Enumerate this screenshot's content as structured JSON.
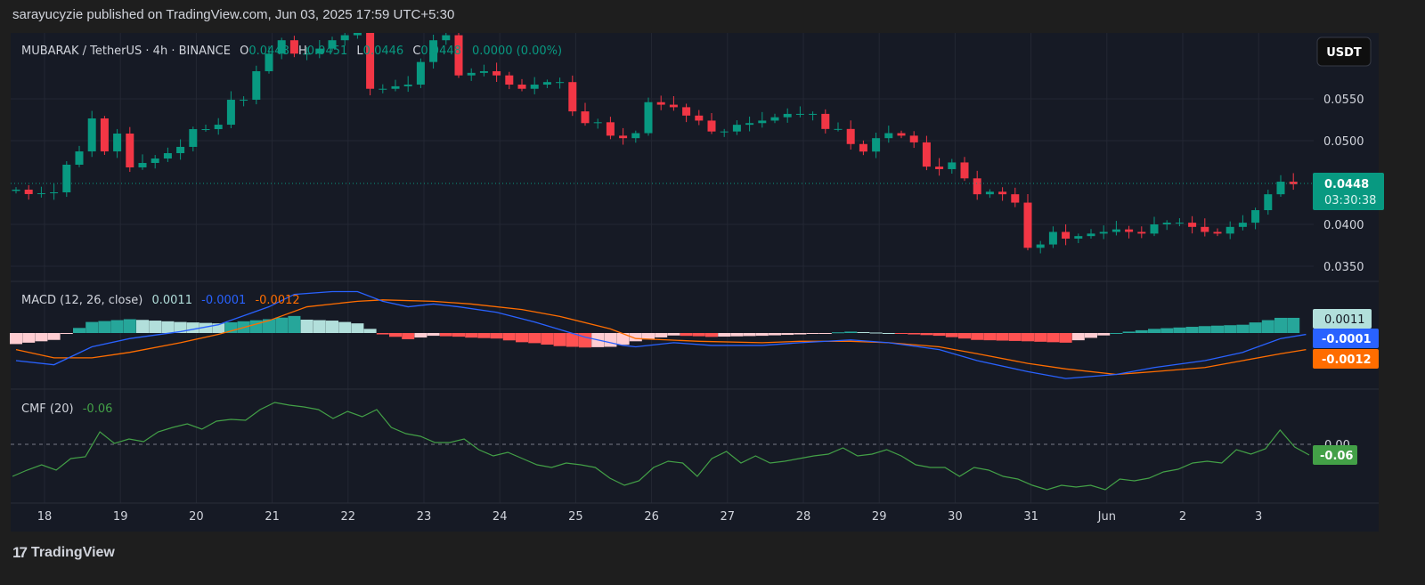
{
  "header": {
    "published": "sarayucyzie published on TradingView.com, Jun 03, 2025 17:59 UTC+5:30"
  },
  "legend": {
    "symbol": "MUBARAK / TetherUS · 4h · BINANCE",
    "o_label": "O",
    "o": "0.0448",
    "h_label": "H",
    "h": "0.0451",
    "l_label": "L",
    "l": "0.0446",
    "c_label": "C",
    "c": "0.0448",
    "change": "0.0000 (0.00%)"
  },
  "currency_button": "USDT",
  "footer": {
    "brand": "TradingView"
  },
  "colors": {
    "up": "#089981",
    "down": "#f23645",
    "macd": "#2962ff",
    "signal": "#ff6d00",
    "cmf": "#43a047",
    "bg": "#161a25"
  },
  "chart_data": [
    {
      "type": "candlestick",
      "title": "MUBARAK / TetherUS 4h",
      "price_ticks": [
        "0.0550",
        "0.0500",
        "0.0400",
        "0.0350"
      ],
      "price_tick_values": [
        0.055,
        0.05,
        0.04,
        0.035
      ],
      "x_ticks": [
        "18",
        "19",
        "20",
        "21",
        "22",
        "23",
        "24",
        "25",
        "26",
        "27",
        "28",
        "29",
        "30",
        "31",
        "Jun",
        "2",
        "3"
      ],
      "last_price": "0.0448",
      "countdown": "03:30:38",
      "first_open": 0.044,
      "closes": [
        0.04415,
        0.04362,
        0.04372,
        0.04383,
        0.04713,
        0.04872,
        0.05266,
        0.04872,
        0.05085,
        0.04681,
        0.04734,
        0.04787,
        0.04851,
        0.04926,
        0.05138,
        0.05138,
        0.05191,
        0.05489,
        0.05489,
        0.0583,
        0.0604,
        0.062,
        0.0604,
        0.0604,
        0.061,
        0.062,
        0.0626,
        0.0636,
        0.0562,
        0.0562,
        0.0565,
        0.0567,
        0.0594,
        0.062,
        0.0626,
        0.0578,
        0.0581,
        0.0583,
        0.0578,
        0.0567,
        0.0562,
        0.0567,
        0.057,
        0.057,
        0.0535,
        0.0521,
        0.0522,
        0.0506,
        0.0503,
        0.0509,
        0.0546,
        0.0543,
        0.054,
        0.053,
        0.0524,
        0.0511,
        0.0511,
        0.0519,
        0.0521,
        0.0524,
        0.0528,
        0.0532,
        0.0532,
        0.0532,
        0.0514,
        0.0514,
        0.0496,
        0.0487,
        0.0503,
        0.0509,
        0.0506,
        0.0498,
        0.0469,
        0.0466,
        0.0474,
        0.0455,
        0.0436,
        0.0439,
        0.0436,
        0.0426,
        0.0372,
        0.0376,
        0.0391,
        0.0383,
        0.0386,
        0.0389,
        0.0391,
        0.0394,
        0.0391,
        0.0389,
        0.04,
        0.0402,
        0.0402,
        0.0397,
        0.0391,
        0.0389,
        0.0397,
        0.0402,
        0.0417,
        0.0436,
        0.0451,
        0.0448
      ]
    },
    {
      "type": "line",
      "title": "MACD (12, 26, close)",
      "values_label": {
        "hist": "0.0011",
        "macd": "-0.0001",
        "signal": "-0.0012"
      },
      "macd": [
        [
          0,
          -0.002
        ],
        [
          3,
          -0.0023
        ],
        [
          6,
          -0.001
        ],
        [
          9,
          -0.0004
        ],
        [
          13,
          0.0001
        ],
        [
          16,
          0.0006
        ],
        [
          20,
          0.0019
        ],
        [
          22,
          0.0028
        ],
        [
          25,
          0.003
        ],
        [
          27,
          0.003
        ],
        [
          29,
          0.0023
        ],
        [
          31,
          0.0019
        ],
        [
          33,
          0.0021
        ],
        [
          35,
          0.0019
        ],
        [
          38,
          0.0015
        ],
        [
          41,
          0.0008
        ],
        [
          45,
          -0.0003
        ],
        [
          48,
          -0.0009
        ],
        [
          49,
          -0.001
        ],
        [
          52,
          -0.0007
        ],
        [
          55,
          -0.0009
        ],
        [
          59,
          -0.0009
        ],
        [
          62,
          -0.0007
        ],
        [
          66,
          -0.0005
        ],
        [
          69,
          -0.0007
        ],
        [
          73,
          -0.0012
        ],
        [
          76,
          -0.002
        ],
        [
          80,
          -0.0028
        ],
        [
          83,
          -0.0033
        ],
        [
          87,
          -0.003
        ],
        [
          90,
          -0.0025
        ],
        [
          94,
          -0.002
        ],
        [
          97,
          -0.0014
        ],
        [
          100,
          -0.0004
        ],
        [
          102,
          -0.0001
        ]
      ],
      "signal": [
        [
          0,
          -0.0012
        ],
        [
          3,
          -0.0018
        ],
        [
          6,
          -0.0018
        ],
        [
          9,
          -0.0014
        ],
        [
          13,
          -0.0007
        ],
        [
          16,
          -0.0001
        ],
        [
          20,
          0.0009
        ],
        [
          23,
          0.0019
        ],
        [
          27,
          0.0023
        ],
        [
          29,
          0.0024
        ],
        [
          33,
          0.0023
        ],
        [
          36,
          0.0021
        ],
        [
          40,
          0.0017
        ],
        [
          43,
          0.0012
        ],
        [
          47,
          0.0003
        ],
        [
          49,
          -0.0004
        ],
        [
          54,
          -0.0006
        ],
        [
          59,
          -0.0007
        ],
        [
          62,
          -0.0006
        ],
        [
          66,
          -0.0006
        ],
        [
          69,
          -0.0007
        ],
        [
          73,
          -0.001
        ],
        [
          76,
          -0.0015
        ],
        [
          80,
          -0.0022
        ],
        [
          83,
          -0.0026
        ],
        [
          87,
          -0.003
        ],
        [
          90,
          -0.0028
        ],
        [
          94,
          -0.0025
        ],
        [
          97,
          -0.002
        ],
        [
          100,
          -0.0015
        ],
        [
          102,
          -0.0012
        ]
      ]
    },
    {
      "type": "line",
      "title": "CMF (20)",
      "value_label": "-0.06",
      "zero_label": "0.00",
      "values": [
        -0.18,
        -0.145,
        -0.115,
        -0.145,
        -0.08,
        -0.07,
        0.07,
        0.005,
        0.03,
        0.015,
        0.07,
        0.095,
        0.115,
        0.085,
        0.13,
        0.14,
        0.135,
        0.195,
        0.235,
        0.22,
        0.21,
        0.195,
        0.145,
        0.185,
        0.155,
        0.195,
        0.095,
        0.06,
        0.045,
        0.01,
        0.01,
        0.03,
        -0.03,
        -0.065,
        -0.045,
        -0.08,
        -0.115,
        -0.13,
        -0.105,
        -0.115,
        -0.13,
        -0.19,
        -0.23,
        -0.205,
        -0.13,
        -0.095,
        -0.105,
        -0.18,
        -0.08,
        -0.04,
        -0.105,
        -0.065,
        -0.105,
        -0.095,
        -0.08,
        -0.065,
        -0.055,
        -0.02,
        -0.065,
        -0.055,
        -0.03,
        -0.065,
        -0.115,
        -0.13,
        -0.13,
        -0.18,
        -0.13,
        -0.145,
        -0.18,
        -0.195,
        -0.23,
        -0.255,
        -0.23,
        -0.24,
        -0.23,
        -0.255,
        -0.195,
        -0.205,
        -0.19,
        -0.155,
        -0.14,
        -0.105,
        -0.095,
        -0.105,
        -0.03,
        -0.055,
        -0.025,
        0.08,
        -0.015,
        -0.06
      ]
    }
  ]
}
